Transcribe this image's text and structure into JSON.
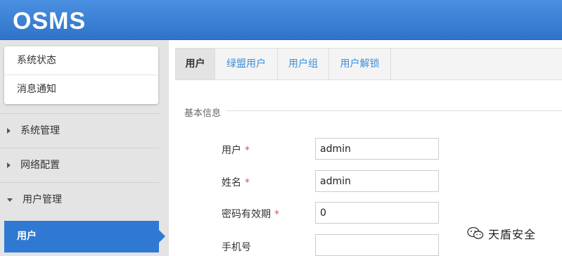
{
  "header": {
    "brand": "OSMS",
    "color": "#3a82d8"
  },
  "quick_menu": [
    {
      "label": "系统状态"
    },
    {
      "label": "消息通知"
    }
  ],
  "nav": {
    "groups": [
      {
        "label": "系统管理",
        "expanded": false
      },
      {
        "label": "网络配置",
        "expanded": false
      },
      {
        "label": "用户管理",
        "expanded": true
      }
    ],
    "active_item": "用户",
    "active_color": "#2f79d3"
  },
  "tabs": [
    {
      "label": "用户",
      "active": true
    },
    {
      "label": "绿盟用户",
      "active": false
    },
    {
      "label": "用户组",
      "active": false
    },
    {
      "label": "用户解锁",
      "active": false
    }
  ],
  "form": {
    "section_title": "基本信息",
    "fields": [
      {
        "label": "用户",
        "required": true,
        "value": "admin"
      },
      {
        "label": "姓名",
        "required": true,
        "value": "admin"
      },
      {
        "label": "密码有效期",
        "required": true,
        "value": "0"
      },
      {
        "label": "手机号",
        "required": false,
        "value": ""
      }
    ],
    "required_mark": "*"
  },
  "watermark": {
    "text": "天盾安全",
    "icon": "wechat-icon"
  }
}
